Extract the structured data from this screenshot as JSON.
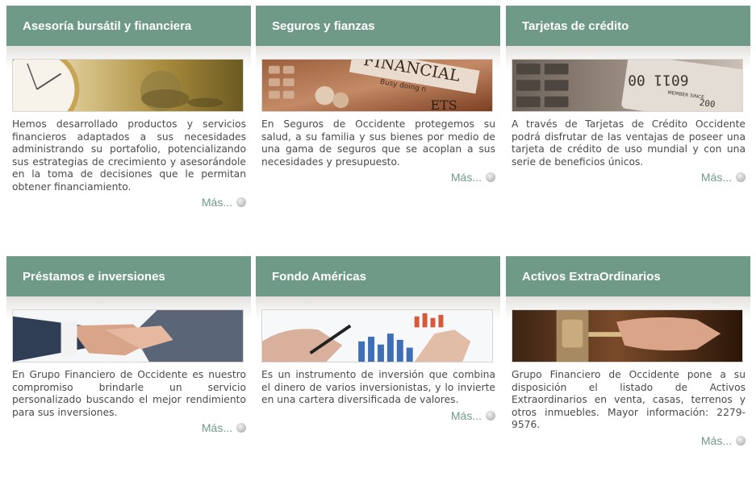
{
  "cards": [
    {
      "title": "Asesoría bursátil y financiera",
      "image_subject": "gold pocket watch over dollar bill",
      "description": "Hemos desarrollado productos y servicios financieros adaptados a sus necesidades administrando su portafolio, potencializando sus estrategias de crecimiento y asesorándole en la toma de decisiones que le permitan obtener financiamiento.",
      "more_label": "Más...",
      "icon": "circle-arrow-icon"
    },
    {
      "title": "Seguros y fianzas",
      "image_subject": "calculator and financial documents",
      "image_text": [
        "FINANCIAL",
        "Busy doing n",
        "ETS"
      ],
      "description": "En Seguros de Occidente protegemos su salud, a su familia y sus bienes por medio de una gama de seguros que se acoplan a sus necesidades y presupuesto.",
      "more_label": "Más...",
      "icon": "circle-arrow-icon"
    },
    {
      "title": "Tarjetas de crédito",
      "image_subject": "credit cards and calculator keys",
      "image_text": [
        "6011 00",
        "MEMBER SINCE",
        "200"
      ],
      "description": "A través de Tarjetas de Crédito Occidente podrá disfrutar de las ventajas de poseer una tarjeta de crédito de uso mundial y con una serie de beneficios únicos.",
      "more_label": "Más...",
      "icon": "circle-arrow-icon"
    },
    {
      "title": "Préstamos e inversiones",
      "image_subject": "handshake between business people",
      "description": "En Grupo Financiero de Occidente es nuestro compromiso brindarle un servicio personalizado buscando el mejor rendimiento para sus inversiones.",
      "more_label": "Más...",
      "icon": "circle-arrow-icon"
    },
    {
      "title": "Fondo Américas",
      "image_subject": "hand with pen over bar charts",
      "description": "Es un instrumento de inversión que combina el dinero de varios inversionistas, y lo invierte en una cartera diversificada de valores.",
      "more_label": "Más...",
      "icon": "circle-arrow-icon"
    },
    {
      "title": "Activos ExtraOrdinarios",
      "image_subject": "hand inserting key into lock",
      "description": "Grupo Financiero de Occidente pone a su disposición el listado de Activos Extraordinarios en venta, casas, terrenos y otros inmuebles. Mayor información: 2279-9576.",
      "more_label": "Más...",
      "icon": "circle-arrow-icon"
    }
  ],
  "colors": {
    "header_bg": "#6e9a87",
    "header_text": "#ffffff",
    "body_text": "#4a4a4a",
    "link": "#6e9a87"
  }
}
